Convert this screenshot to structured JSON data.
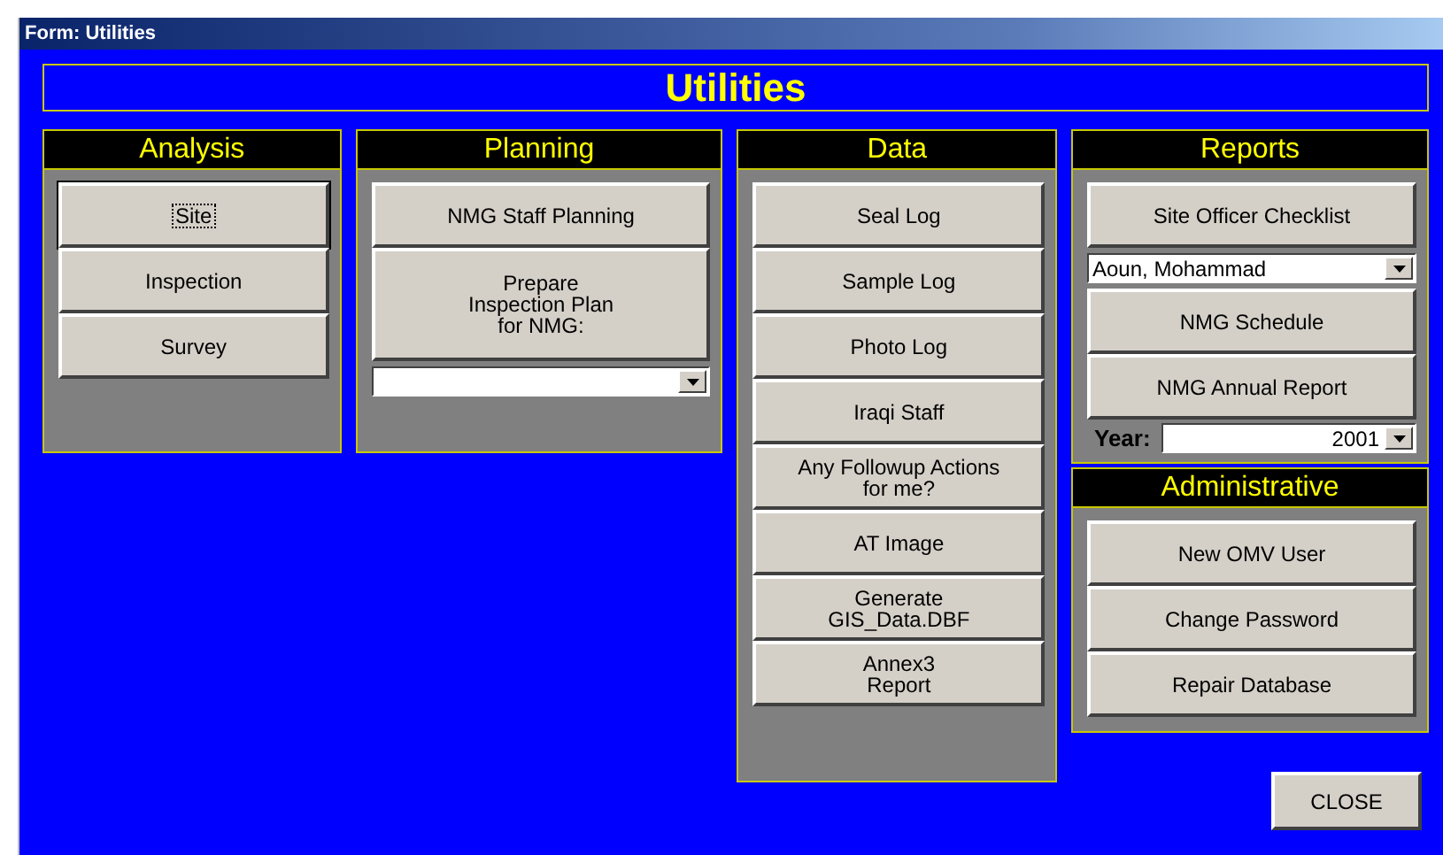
{
  "window": {
    "title": "Form: Utilities"
  },
  "heading": "Utilities",
  "panels": [
    {
      "title": "Analysis",
      "items": [
        {
          "kind": "button",
          "label": "Site",
          "focused": true
        },
        {
          "kind": "button",
          "label": "Inspection",
          "focused": false
        },
        {
          "kind": "button",
          "label": "Survey",
          "focused": false
        }
      ]
    },
    {
      "title": "Planning",
      "items": [
        {
          "kind": "button",
          "label": "NMG Staff Planning",
          "focused": false
        },
        {
          "kind": "button",
          "label": "Prepare\nInspection Plan\nfor NMG:",
          "focused": false
        },
        {
          "kind": "combo"
        }
      ]
    },
    {
      "title": "Data",
      "items": [
        {
          "kind": "button",
          "label": "Seal Log",
          "focused": false
        },
        {
          "kind": "button",
          "label": "Sample Log",
          "focused": false
        },
        {
          "kind": "button",
          "label": "Photo Log",
          "focused": false
        },
        {
          "kind": "button",
          "label": "Iraqi Staff",
          "focused": false
        },
        {
          "kind": "button",
          "label": "Any Followup Actions\nfor me?",
          "focused": false
        },
        {
          "kind": "button",
          "label": "AT Image",
          "focused": false
        },
        {
          "kind": "button",
          "label": "Generate\nGIS_Data.DBF",
          "focused": false
        },
        {
          "kind": "button",
          "label": "Annex3\nReport",
          "focused": false
        }
      ]
    },
    {
      "title": "Reports",
      "items": [
        {
          "kind": "button",
          "label": "Site Officer Checklist",
          "focused": false
        },
        {
          "kind": "combo",
          "value": "Aoun, Mohammad"
        },
        {
          "kind": "button",
          "label": "NMG Schedule",
          "focused": false
        },
        {
          "kind": "button",
          "label": "NMG Annual Report",
          "focused": false
        },
        {
          "kind": "labeled_combo",
          "label": "Year:",
          "value": "2001"
        }
      ]
    },
    {
      "title": "Administrative",
      "items": [
        {
          "kind": "button",
          "label": "New OMV User",
          "focused": false
        },
        {
          "kind": "button",
          "label": "Change Password",
          "focused": false
        },
        {
          "kind": "button",
          "label": "Repair Database",
          "focused": false
        }
      ]
    }
  ],
  "close_button": "CLOSE"
}
